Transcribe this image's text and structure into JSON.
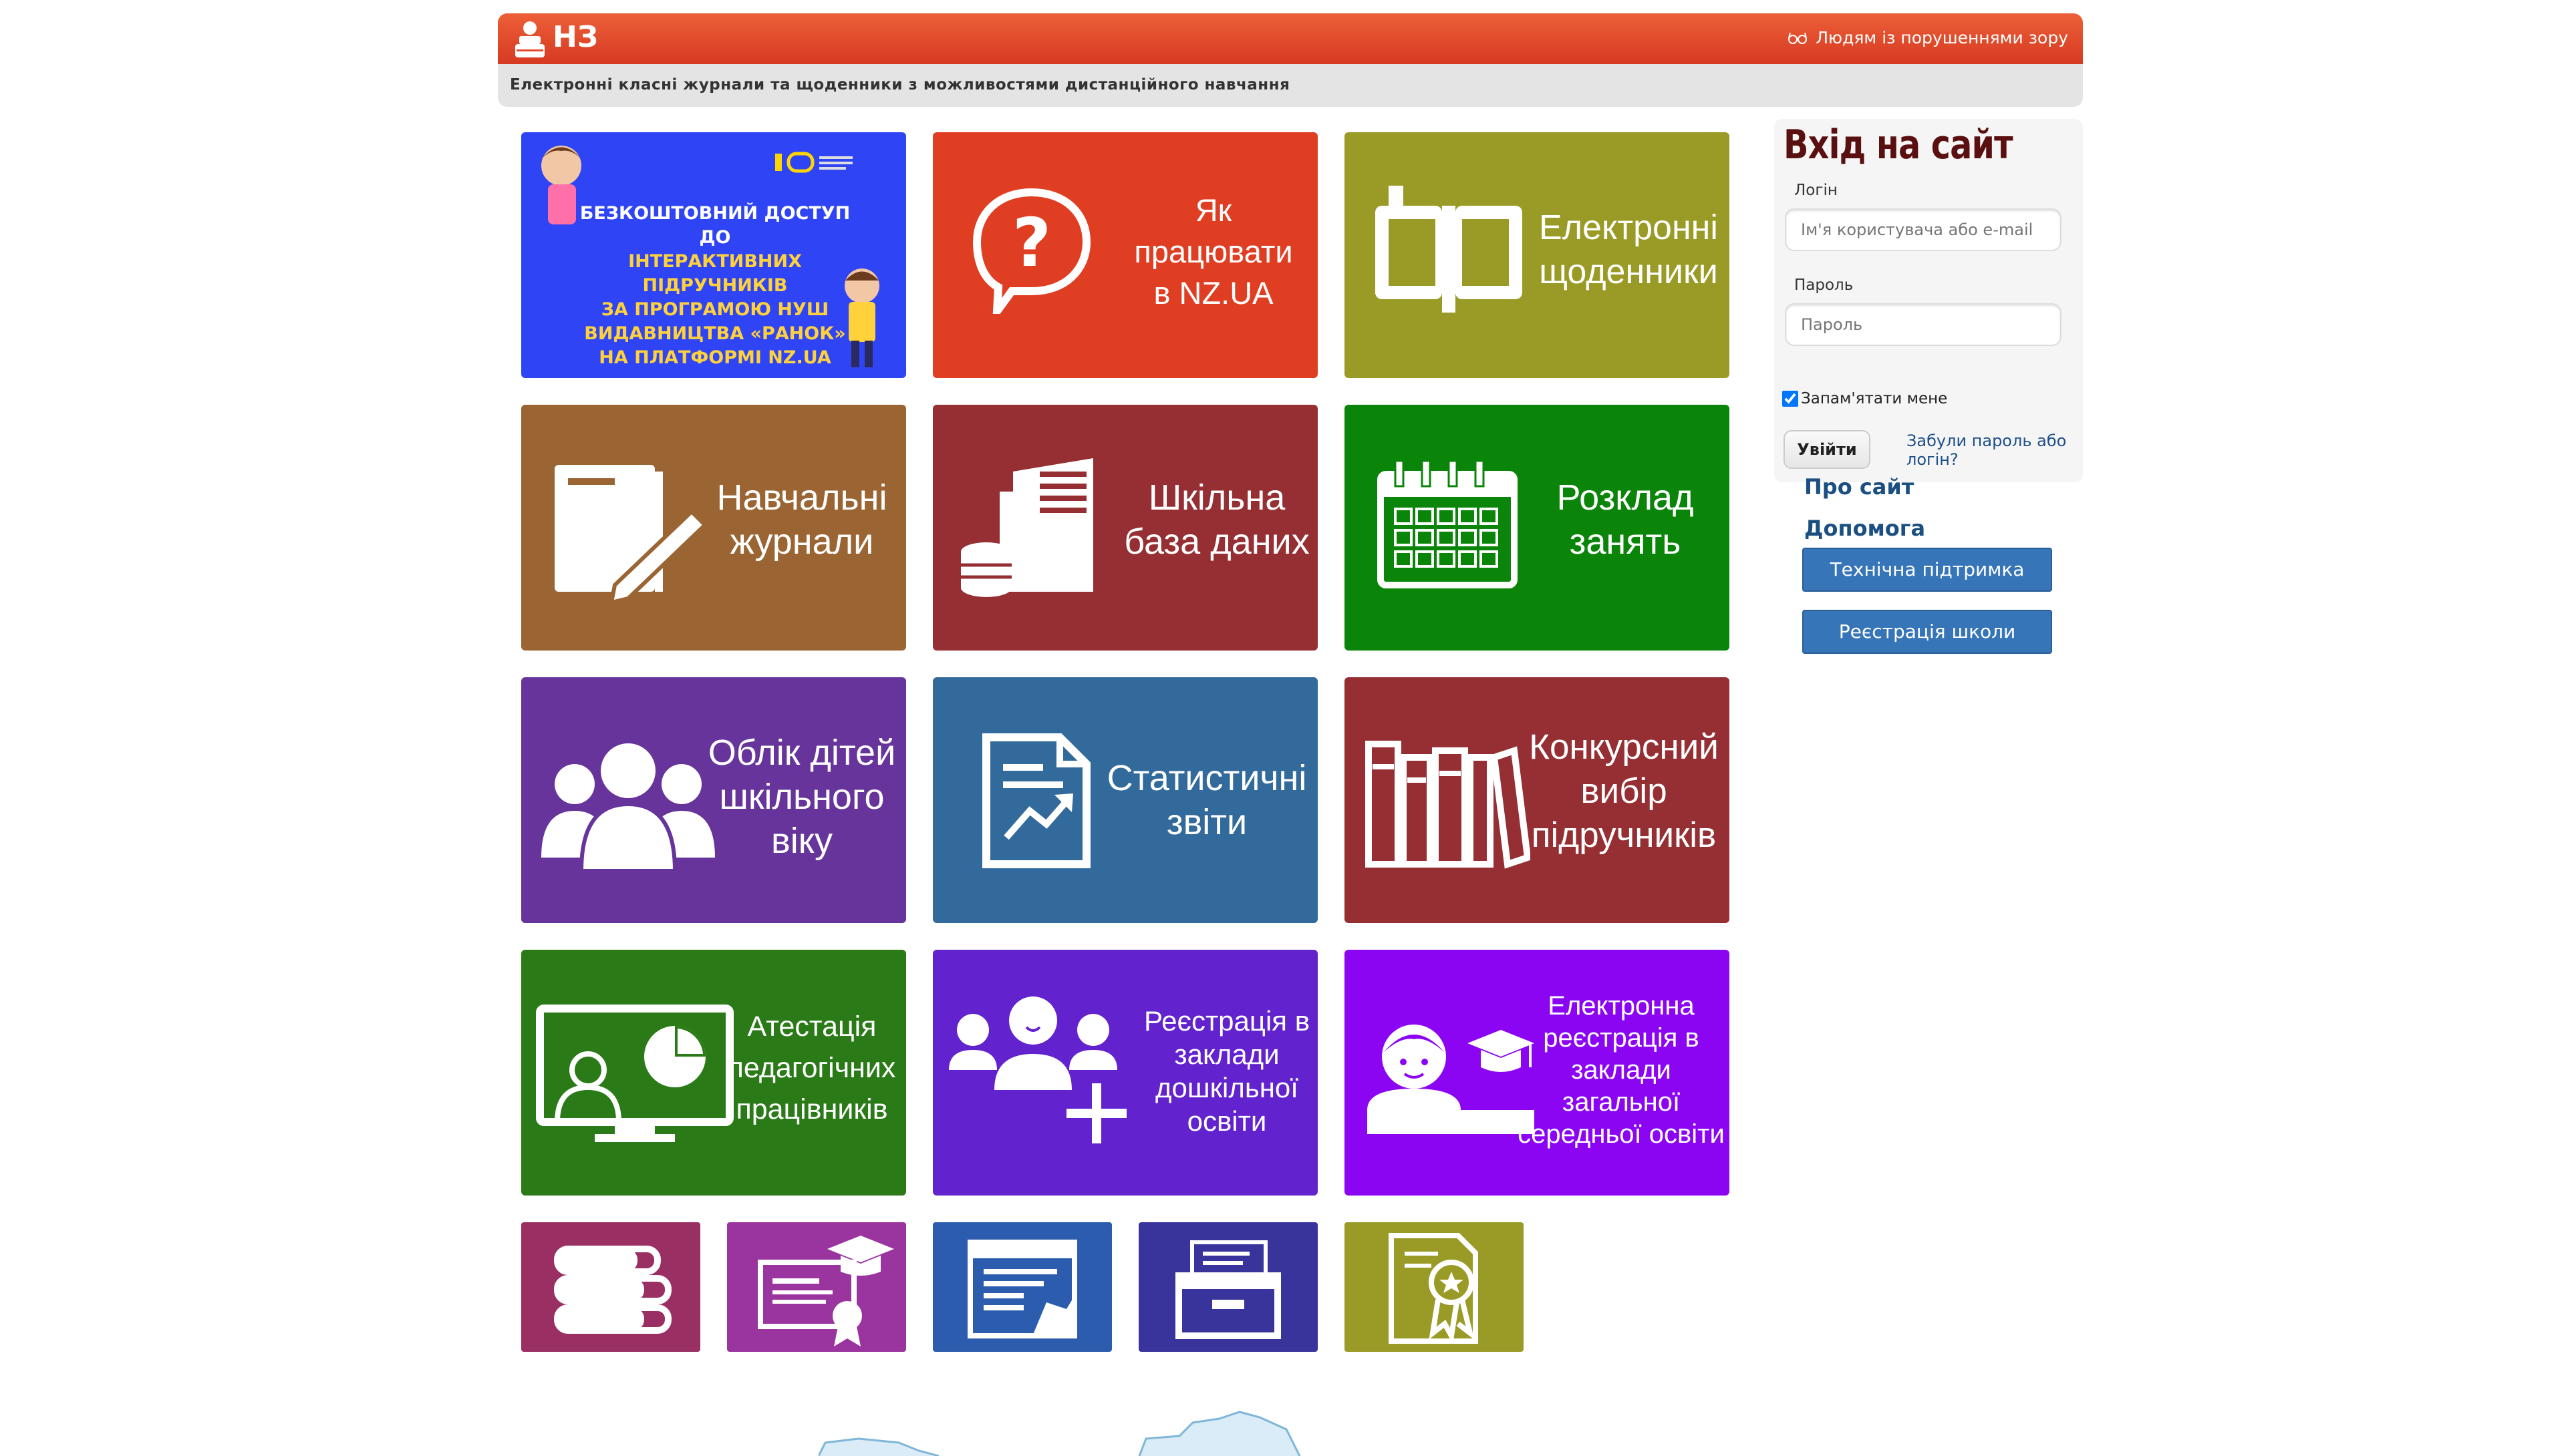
{
  "header": {
    "logo_text": "НЗ",
    "accessibility_link": "Людям із порушеннями зору",
    "tagline": "Електронні класні журнали та щоденники з можливостями дистанційного навчання"
  },
  "banner": {
    "lines": [
      "БЕЗКОШТОВНИЙ ДОСТУП ДО",
      "ІНТЕРАКТИВНИХ ПІДРУЧНИКІВ",
      "ЗА ПРОГРАМОЮ НУШ",
      "ВИДАВНИЦТВА «РАНОК»",
      "НА ПЛАТФОРМІ NZ.UA"
    ]
  },
  "tiles": {
    "how_to": {
      "line1": "Як",
      "line2": "працювати",
      "line3": "в NZ.UA",
      "color": "#e03e23"
    },
    "diaries": {
      "line1": "Електронні",
      "line2": "щоденники",
      "color": "#9a9a26"
    },
    "journals": {
      "line1": "Навчальні",
      "line2": "журнали",
      "color": "#9a6433"
    },
    "database": {
      "line1": "Шкільна",
      "line2": "база даних",
      "color": "#952f33"
    },
    "schedule": {
      "line1": "Розклад",
      "line2": "занять",
      "color": "#0a8509"
    },
    "children": {
      "line1": "Облік дітей",
      "line2": "шкільного",
      "line3": "віку",
      "color": "#66349a"
    },
    "stats": {
      "line1": "Статистичні",
      "line2": "звіти",
      "color": "#336a9c"
    },
    "textbooks": {
      "line1": "Конкурсний",
      "line2": "вибір",
      "line3": "підручників",
      "color": "#952f33"
    },
    "attestation": {
      "line1": "Атестація",
      "line2": "педагогічних",
      "line3": "працівників",
      "color": "#2a7a17"
    },
    "preschool": {
      "line1": "Реєстрація в",
      "line2": "заклади",
      "line3": "дошкільної",
      "line4": "освіти",
      "color": "#6223cf"
    },
    "school_reg": {
      "line1": "Електронна",
      "line2": "реєстрація в",
      "line3": "заклади",
      "line4": "загальної",
      "line5": "середньої освіти",
      "color": "#8b05f3"
    }
  },
  "small_tiles": [
    {
      "icon": "books-stack-icon",
      "color": "#9a2f64"
    },
    {
      "icon": "diploma-icon",
      "color": "#9a349e"
    },
    {
      "icon": "web-document-icon",
      "color": "#2b5cae"
    },
    {
      "icon": "archive-box-icon",
      "color": "#38349b"
    },
    {
      "icon": "certificate-icon",
      "color": "#9a9a26"
    }
  ],
  "login": {
    "title": "Вхід на сайт",
    "login_label": "Логін",
    "login_placeholder": "Ім'я користувача або e-mail",
    "password_label": "Пароль",
    "password_placeholder": "Пароль",
    "remember_label": "Запам'ятати мене",
    "remember_checked": true,
    "submit_label": "Увійти",
    "forgot_label": "Забули пароль або логін?"
  },
  "sidebar": {
    "about": "Про сайт",
    "help": "Допомога",
    "support_button": "Технічна підтримка",
    "register_button": "Реєстрація школи"
  }
}
